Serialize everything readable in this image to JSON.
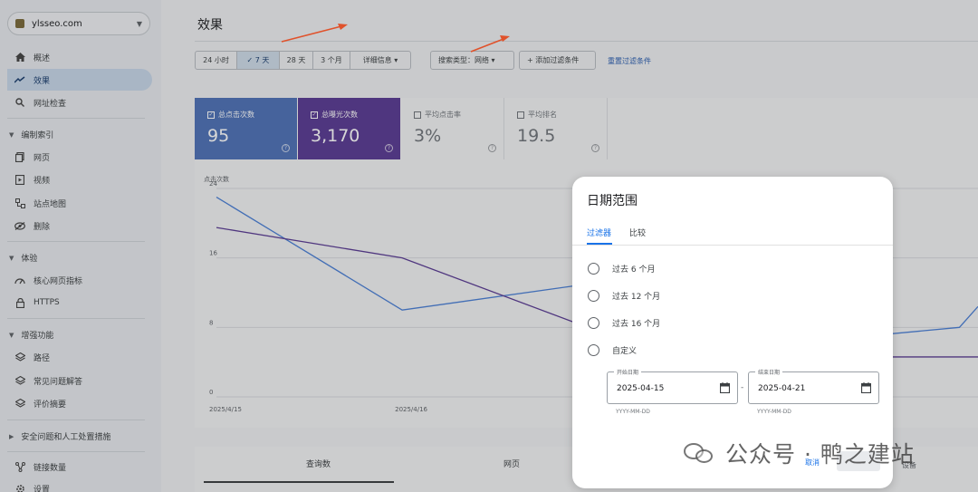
{
  "sidebar": {
    "property": "ylsseo.com",
    "items": [
      {
        "label": "概述",
        "icon": "home-icon",
        "active": false
      },
      {
        "label": "效果",
        "icon": "trending-icon",
        "active": true
      },
      {
        "label": "网址检查",
        "icon": "search-icon",
        "active": false
      }
    ],
    "groups": [
      {
        "label": "编制索引",
        "items": [
          {
            "label": "网页",
            "icon": "pages-icon"
          },
          {
            "label": "视频",
            "icon": "video-icon"
          },
          {
            "label": "站点地图",
            "icon": "sitemap-icon"
          },
          {
            "label": "删除",
            "icon": "eye-off-icon"
          }
        ]
      },
      {
        "label": "体验",
        "items": [
          {
            "label": "核心网页指标",
            "icon": "speed-icon"
          },
          {
            "label": "HTTPS",
            "icon": "lock-icon"
          }
        ]
      },
      {
        "label": "增强功能",
        "items": [
          {
            "label": "路径",
            "icon": "layers-icon"
          },
          {
            "label": "常见问题解答",
            "icon": "layers-icon"
          },
          {
            "label": "评价摘要",
            "icon": "layers-icon"
          }
        ]
      }
    ],
    "security_group": "安全问题和人工处置措施",
    "links_item": "链接数量",
    "settings_item": "设置"
  },
  "main": {
    "title": "效果",
    "date_segments": [
      "24 小时",
      "✓ 7 天",
      "28 天",
      "3 个月",
      "详细信息 ▾"
    ],
    "search_type": "搜索类型：网络 ▾",
    "add_filter": "+ 添加过滤条件",
    "reset_filters": "重置过滤条件"
  },
  "cards": [
    {
      "label": "总点击次数",
      "value": "95",
      "checked": true
    },
    {
      "label": "总曝光次数",
      "value": "3,170",
      "checked": true
    },
    {
      "label": "平均点击率",
      "value": "3%",
      "checked": false
    },
    {
      "label": "平均排名",
      "value": "19.5",
      "checked": false
    }
  ],
  "chart_data": {
    "type": "line",
    "ylabel": "点击次数",
    "yticks": [
      0,
      8,
      16,
      24
    ],
    "ylim": [
      0,
      24
    ],
    "xticks": [
      "2025/4/15",
      "2025/4/16"
    ],
    "x_visible_range": [
      0,
      4.1
    ],
    "series": [
      {
        "color": "#4a7fd6",
        "x": [
          0,
          1,
          2,
          3,
          4,
          4.1
        ],
        "y": [
          23,
          10,
          13,
          6,
          8,
          10.4
        ]
      },
      {
        "color": "#5a3b94",
        "x": [
          0,
          1,
          2,
          3,
          4,
          4.1
        ],
        "y": [
          19.5,
          16,
          8,
          4.6,
          4.6,
          4.6
        ]
      }
    ]
  },
  "bottom_tabs": [
    "查询数",
    "网页",
    "设备"
  ],
  "dialog": {
    "title": "日期范围",
    "tabs": [
      "过滤器",
      "比较"
    ],
    "options": [
      "过去 6 个月",
      "过去 12 个月",
      "过去 16 个月",
      "自定义"
    ],
    "start_label": "开始日期",
    "start_value": "2025-04-15",
    "end_label": "结束日期",
    "end_value": "2025-04-21",
    "format_hint": "YYYY-MM-DD",
    "separator": "-",
    "cancel": "取消"
  },
  "watermark": "公众号 · 鸭之建站",
  "colors": {
    "accent": "#1a73e8",
    "arrow": "#e0522b",
    "blue_card": "#4f72b8",
    "purple_card": "#5a3b94"
  }
}
